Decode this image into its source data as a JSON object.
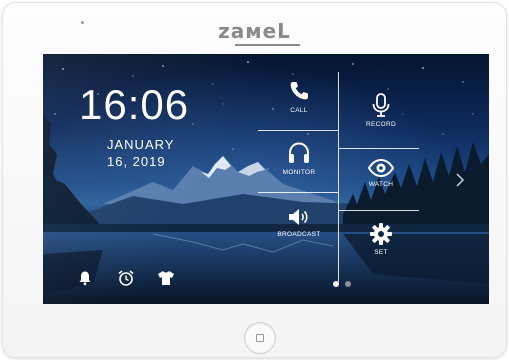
{
  "brand": {
    "name": "zaмeL"
  },
  "clock": {
    "time": "16:06",
    "month": "JANUARY",
    "day_year": "16, 2019"
  },
  "tiles": {
    "call": {
      "label": "CALL",
      "icon": "phone-icon"
    },
    "record": {
      "label": "RECORD",
      "icon": "microphone-icon"
    },
    "monitor": {
      "label": "MONITOR",
      "icon": "headphones-icon"
    },
    "watch": {
      "label": "WATCH",
      "icon": "eye-icon"
    },
    "broadcast": {
      "label": "BROADCAST",
      "icon": "speaker-icon"
    },
    "set": {
      "label": "SET",
      "icon": "gear-icon"
    }
  },
  "bottom_icons": [
    "bell-icon",
    "alarm-clock-icon",
    "shirt-icon"
  ],
  "pager": {
    "pages": 2,
    "active": 1
  },
  "colors": {
    "brand_gray": "#8a8a8a",
    "tile_text": "#ffffff",
    "dot_active": "#ffffff",
    "dot_inactive": "#8a8f9a"
  }
}
